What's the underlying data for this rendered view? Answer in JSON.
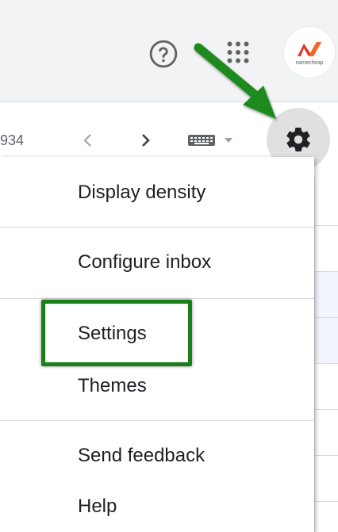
{
  "header": {
    "help_icon": "help-circle-icon",
    "apps_icon": "apps-grid-icon",
    "avatar": {
      "brand_text": "namecheap",
      "brand_color": "#de3723"
    }
  },
  "toolbar": {
    "page_count": "934",
    "prev_icon": "chevron-left-icon",
    "next_icon": "chevron-right-icon",
    "keyboard_icon": "keyboard-icon",
    "settings_icon": "gear-icon"
  },
  "menu": {
    "items": [
      {
        "label": "Display density"
      },
      {
        "label": "Configure inbox"
      },
      {
        "label": "Settings"
      },
      {
        "label": "Themes"
      },
      {
        "label": "Send feedback"
      },
      {
        "label": "Help"
      }
    ]
  },
  "annotation": {
    "color": "#1a7f1a",
    "highlighted_item": "Settings"
  }
}
